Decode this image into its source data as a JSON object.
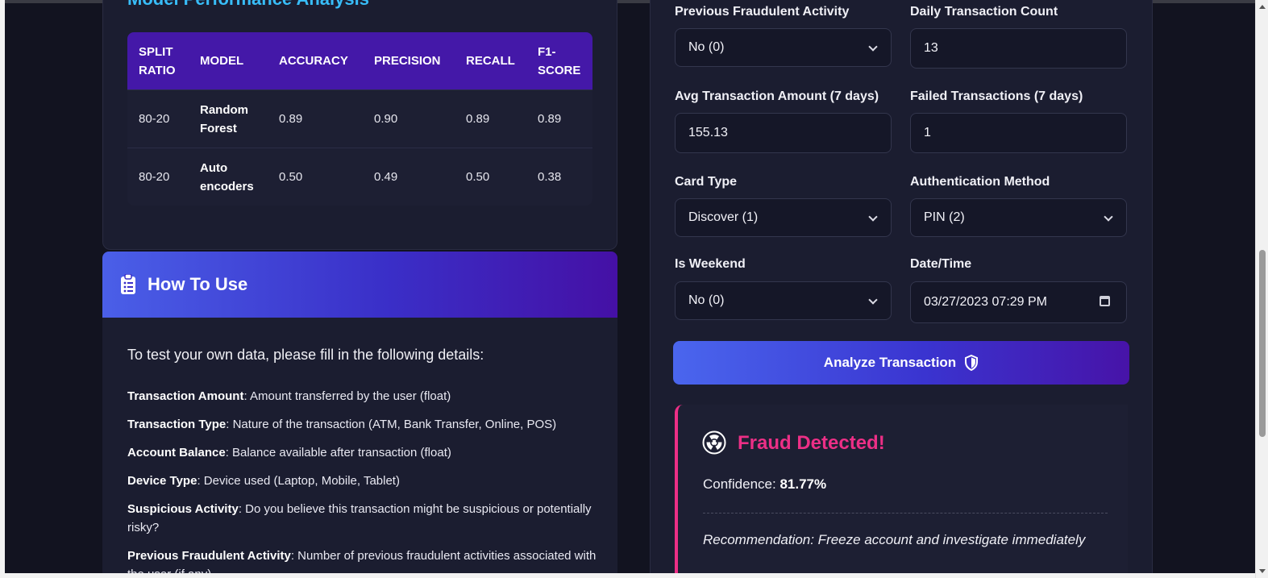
{
  "left": {
    "section_title": "Model Performance Analysis",
    "table": {
      "headers": [
        "Split Ratio",
        "Model",
        "Accuracy",
        "Precision",
        "Recall",
        "F1-Score"
      ],
      "rows": [
        {
          "split": "80-20",
          "model": "Random Forest",
          "accuracy": "0.89",
          "precision": "0.90",
          "recall": "0.89",
          "f1": "0.89"
        },
        {
          "split": "80-20",
          "model": "Auto encoders",
          "accuracy": "0.50",
          "precision": "0.49",
          "recall": "0.50",
          "f1": "0.38"
        }
      ]
    },
    "howto": {
      "icon": "clipboard-list-icon",
      "title": "How To Use",
      "intro": "To test your own data, please fill in the following details:",
      "items": [
        {
          "term": "Transaction Amount",
          "desc": ": Amount transferred by the user (float)"
        },
        {
          "term": "Transaction Type",
          "desc": ": Nature of the transaction (ATM, Bank Transfer, Online, POS)"
        },
        {
          "term": "Account Balance",
          "desc": ": Balance available after transaction (float)"
        },
        {
          "term": "Device Type",
          "desc": ": Device used (Laptop, Mobile, Tablet)"
        },
        {
          "term": "Suspicious Activity",
          "desc": ": Do you believe this transaction might be suspicious or potentially risky?"
        },
        {
          "term": "Previous Fraudulent Activity",
          "desc": ": Number of previous fraudulent activities associated with the user (if any)"
        }
      ]
    }
  },
  "form": {
    "prev_fraud": {
      "label": "Previous Fraudulent Activity",
      "value": "No (0)"
    },
    "daily_count": {
      "label": "Daily Transaction Count",
      "value": "13"
    },
    "avg_amount": {
      "label": "Avg Transaction Amount (7 days)",
      "value": "155.13"
    },
    "failed_tx": {
      "label": "Failed Transactions (7 days)",
      "value": "1"
    },
    "card_type": {
      "label": "Card Type",
      "value": "Discover (1)"
    },
    "auth_method": {
      "label": "Authentication Method",
      "value": "PIN (2)"
    },
    "is_weekend": {
      "label": "Is Weekend",
      "value": "No (0)"
    },
    "datetime": {
      "label": "Date/Time",
      "value": "03/27/2023 07:29 PM"
    },
    "analyze_button": "Analyze Transaction"
  },
  "result": {
    "icon": "radiation-icon",
    "title": "Fraud Detected!",
    "confidence_label": "Confidence: ",
    "confidence_value": "81.77%",
    "recommendation": "Recommendation: Freeze account and investigate immediately"
  },
  "colors": {
    "accent_pink": "#ec2f86",
    "table_header": "#4418a8",
    "title_blue": "#38bdf8"
  }
}
